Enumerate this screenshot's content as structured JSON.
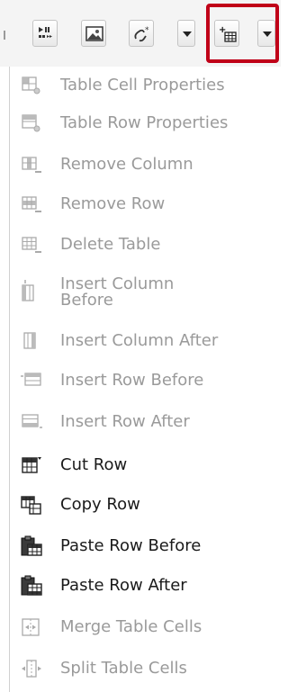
{
  "toolbar": {
    "buttons": [
      {
        "name": "media-player-icon"
      },
      {
        "name": "image-icon"
      },
      {
        "name": "link-icon"
      },
      {
        "name": "table-insert-icon"
      }
    ]
  },
  "menu": {
    "items": [
      {
        "label": "Table Cell Properties",
        "icon": "table-cell-properties-icon",
        "enabled": false
      },
      {
        "label": "Table Row Properties",
        "icon": "table-row-properties-icon",
        "enabled": false
      },
      {
        "label": "Remove Column",
        "icon": "remove-column-icon",
        "enabled": false
      },
      {
        "label": "Remove Row",
        "icon": "remove-row-icon",
        "enabled": false
      },
      {
        "label": "Delete Table",
        "icon": "delete-table-icon",
        "enabled": false
      },
      {
        "label": "Insert Column\nBefore",
        "icon": "insert-column-before-icon",
        "enabled": false
      },
      {
        "label": "Insert Column After",
        "icon": "insert-column-after-icon",
        "enabled": false
      },
      {
        "label": "Insert Row Before",
        "icon": "insert-row-before-icon",
        "enabled": false
      },
      {
        "label": "Insert Row After",
        "icon": "insert-row-after-icon",
        "enabled": false
      },
      {
        "label": "Cut Row",
        "icon": "cut-row-icon",
        "enabled": true
      },
      {
        "label": "Copy Row",
        "icon": "copy-row-icon",
        "enabled": true
      },
      {
        "label": "Paste Row Before",
        "icon": "paste-row-before-icon",
        "enabled": true
      },
      {
        "label": "Paste Row After",
        "icon": "paste-row-after-icon",
        "enabled": true
      },
      {
        "label": "Merge Table Cells",
        "icon": "merge-table-cells-icon",
        "enabled": false
      },
      {
        "label": "Split Table Cells",
        "icon": "split-table-cells-icon",
        "enabled": false
      }
    ]
  },
  "colors": {
    "highlight": "#c00018",
    "disabled_text": "#9a9a9a",
    "enabled_text": "#1a1a1a"
  }
}
